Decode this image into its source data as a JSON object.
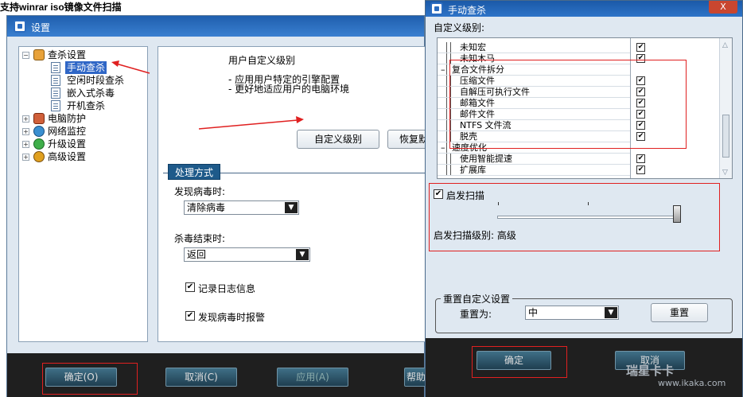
{
  "headline": "支持winrar iso镜像文件扫描",
  "settings_window": {
    "title": "设置",
    "tree": {
      "scan": "查杀设置",
      "manual": "手动查杀",
      "idle": "空闲时段查杀",
      "embedded": "嵌入式杀毒",
      "startup": "开机查杀",
      "pc_protect": "电脑防护",
      "network": "网络监控",
      "upgrade": "升级设置",
      "advanced": "高级设置"
    },
    "panel": {
      "heading": "用户自定义级别",
      "line1": "- 应用用户特定的引擎配置",
      "line2": "- 更好地适应用户的电脑环境",
      "custom_btn": "自定义级别",
      "restore_btn": "恢复默",
      "tab": "处理方式",
      "found_label": "发现病毒时:",
      "found_value": "清除病毒",
      "end_label": "杀毒结束时:",
      "end_value": "返回",
      "log_label": "记录日志信息",
      "alarm_label": "发现病毒时报警"
    },
    "buttons": {
      "ok": "确定(O)",
      "cancel": "取消(C)",
      "apply": "应用(A)",
      "help": "帮助"
    }
  },
  "manual_window": {
    "title": "手动查杀",
    "close": "X",
    "custom_label": "自定义级别:",
    "rows": [
      {
        "label": "未知宏",
        "indent": 1,
        "checked": true
      },
      {
        "label": "未知木马",
        "indent": 1,
        "checked": true
      },
      {
        "label": "复合文件拆分",
        "indent": 0,
        "checked": null
      },
      {
        "label": "压缩文件",
        "indent": 1,
        "checked": true
      },
      {
        "label": "自解压可执行文件",
        "indent": 1,
        "checked": true
      },
      {
        "label": "邮箱文件",
        "indent": 1,
        "checked": true
      },
      {
        "label": "邮件文件",
        "indent": 1,
        "checked": true
      },
      {
        "label": "NTFS 文件流",
        "indent": 1,
        "checked": true
      },
      {
        "label": "脱壳",
        "indent": 1,
        "checked": true
      },
      {
        "label": "速度优化",
        "indent": 0,
        "checked": null
      },
      {
        "label": "使用智能提速",
        "indent": 1,
        "checked": true
      },
      {
        "label": "扩展库",
        "indent": 1,
        "checked": true
      }
    ],
    "heuristic": {
      "label": "启发扫描",
      "checked": true,
      "level_label": "启发扫描级别: 高级"
    },
    "reset_group": {
      "title": "重置自定义设置",
      "label": "重置为:",
      "value": "中",
      "button": "重置"
    },
    "buttons": {
      "ok": "确定",
      "cancel": "取消"
    },
    "watermark": "www.ikaka.com",
    "watermark_cn": "瑞星卡卡"
  }
}
